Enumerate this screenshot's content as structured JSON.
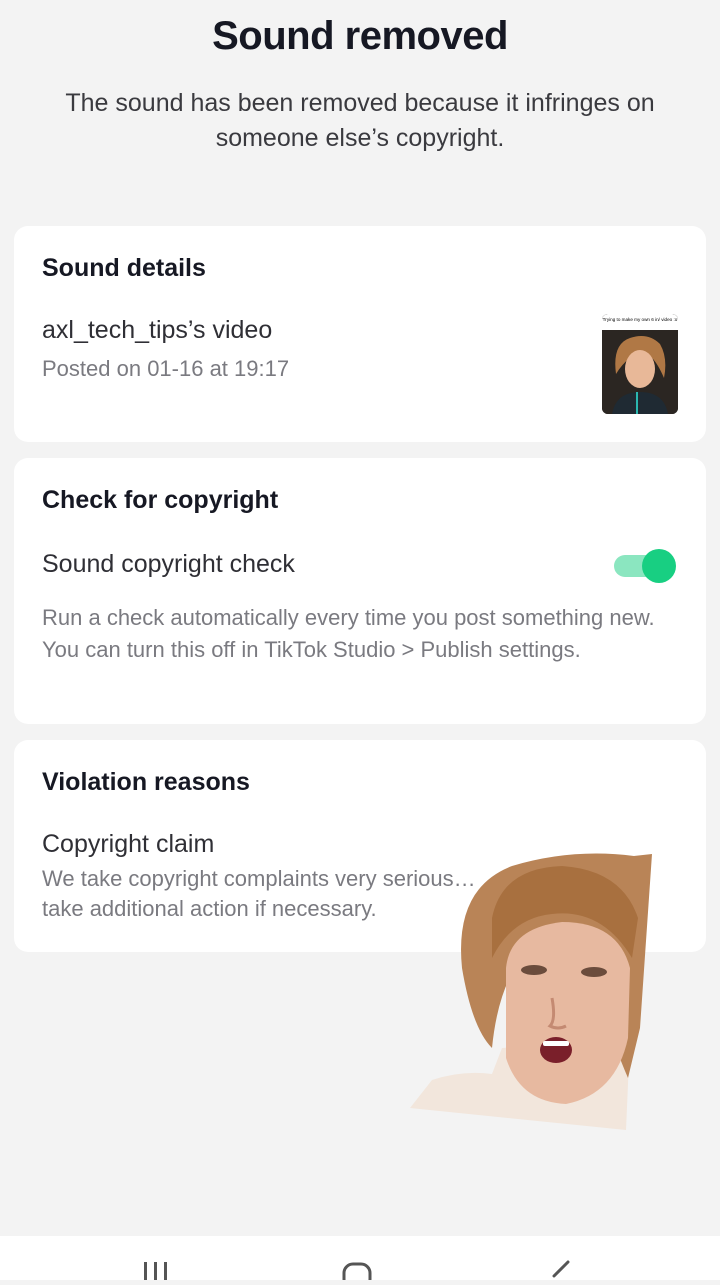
{
  "header": {
    "title": "Sound removed",
    "subtitle": "The sound has been removed because it infringes on someone else’s copyright."
  },
  "sound_details": {
    "heading": "Sound details",
    "video_title": "axl_tech_tips’s video",
    "posted": "Posted on 01-16 at 19:17",
    "thumbnail_caption": "Trying to make my own 6 in/ video :o"
  },
  "copyright_check": {
    "heading": "Check for copyright",
    "label": "Sound copyright check",
    "toggle_on": true,
    "description": "Run a check automatically every time you post something new. You can turn this off in TikTok Studio > Publish settings.",
    "accent_color": "#18cf82"
  },
  "violation": {
    "heading": "Violation reasons",
    "reason_title": "Copyright claim",
    "reason_text": "We take copyright complaints very serious… take additional action if necessary."
  },
  "nav": {
    "icons": [
      "recent-apps-icon",
      "home-icon",
      "back-icon"
    ]
  }
}
